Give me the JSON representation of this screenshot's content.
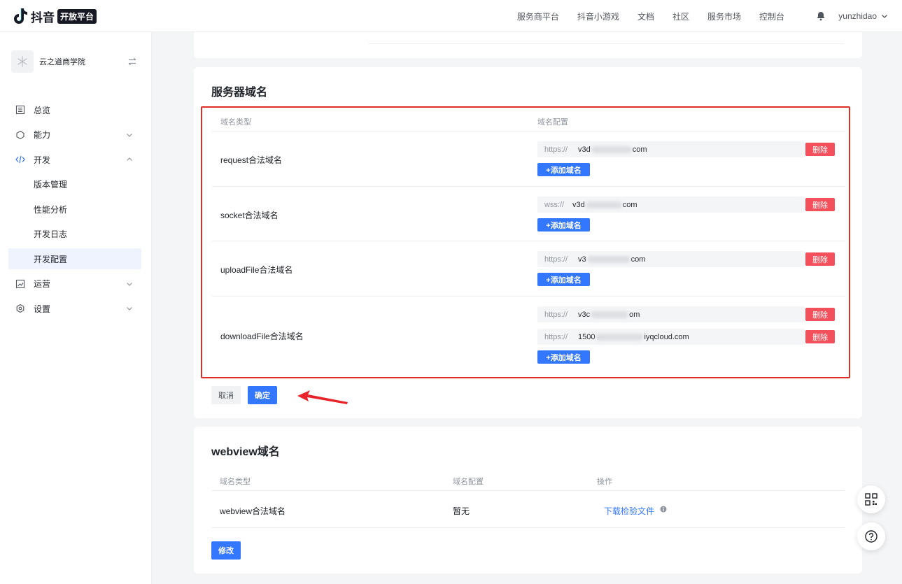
{
  "header": {
    "logo_text": "抖音",
    "logo_badge": "开放平台",
    "nav": [
      "服务商平台",
      "抖音小游戏",
      "文档",
      "社区",
      "服务市场",
      "控制台"
    ],
    "username": "yunzhidao"
  },
  "sidebar": {
    "app_name": "云之道商学院",
    "items": [
      {
        "label": "总览"
      },
      {
        "label": "能力"
      },
      {
        "label": "开发"
      },
      {
        "label": "版本管理"
      },
      {
        "label": "性能分析"
      },
      {
        "label": "开发日志"
      },
      {
        "label": "开发配置"
      },
      {
        "label": "运营"
      },
      {
        "label": "设置"
      }
    ]
  },
  "server_domain": {
    "title": "服务器域名",
    "col_type": "域名类型",
    "col_config": "域名配置",
    "delete_label": "删除",
    "add_label": "+添加域名",
    "rows": [
      {
        "label": "request合法域名",
        "entries": [
          {
            "prefix": "https://",
            "value_start": "v3d",
            "value_end": "com"
          }
        ]
      },
      {
        "label": "socket合法域名",
        "entries": [
          {
            "prefix": "wss://",
            "value_start": "v3d",
            "value_end": "com"
          }
        ]
      },
      {
        "label": "uploadFile合法域名",
        "entries": [
          {
            "prefix": "https://",
            "value_start": "v3",
            "value_end": "com"
          }
        ]
      },
      {
        "label": "downloadFile合法域名",
        "entries": [
          {
            "prefix": "https://",
            "value_start": "v3c",
            "value_end": "om"
          },
          {
            "prefix": "https://",
            "value_start": "1500",
            "value_end": "iyqcloud.com"
          }
        ]
      }
    ],
    "cancel_label": "取消",
    "confirm_label": "确定"
  },
  "webview_domain": {
    "title": "webview域名",
    "col_type": "域名类型",
    "col_config": "域名配置",
    "col_action": "操作",
    "row_label": "webview合法域名",
    "row_value": "暂无",
    "download_link": "下载检验文件",
    "edit_label": "修改"
  },
  "colors": {
    "primary": "#3377ff",
    "danger": "#f4505b",
    "highlight_border": "#e02d26"
  }
}
